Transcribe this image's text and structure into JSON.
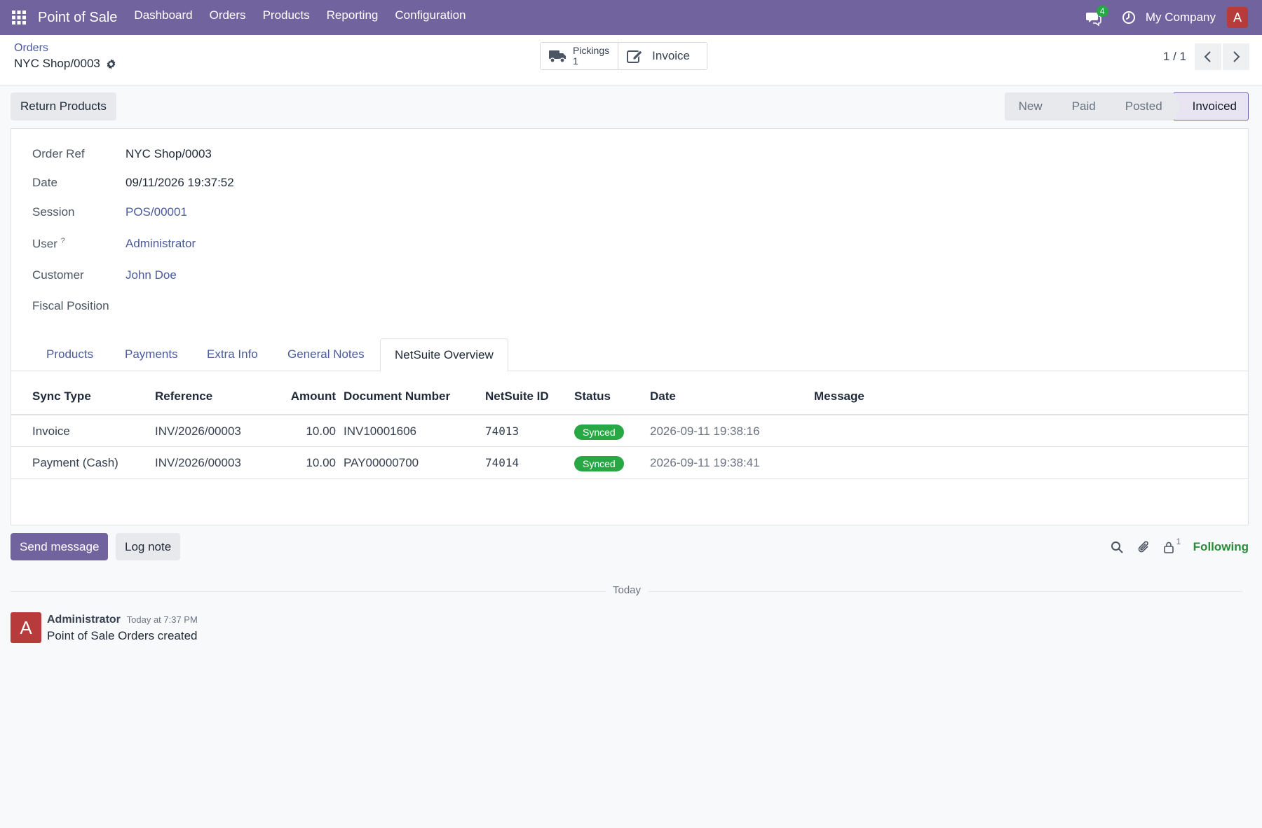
{
  "navbar": {
    "app_name": "Point of Sale",
    "menu": [
      "Dashboard",
      "Orders",
      "Products",
      "Reporting",
      "Configuration"
    ],
    "chat_count": "4",
    "company": "My Company",
    "avatar_letter": "A",
    "icons": [
      "apps-grid-icon",
      "chat-icon",
      "clock-icon"
    ]
  },
  "breadcrumb": {
    "parent": "Orders",
    "current": "NYC Shop/0003"
  },
  "smart_buttons": {
    "pickings_label": "Pickings",
    "pickings_count": "1",
    "invoice_label": "Invoice"
  },
  "pager": {
    "value": "1 / 1"
  },
  "actions": {
    "return_products": "Return Products"
  },
  "statusbar": {
    "stages": [
      "New",
      "Paid",
      "Posted",
      "Invoiced"
    ],
    "current": "Invoiced"
  },
  "form": {
    "order_ref_label": "Order Ref",
    "order_ref": "NYC Shop/0003",
    "date_label": "Date",
    "date": "09/11/2026 19:37:52",
    "session_label": "Session",
    "session": "POS/00001",
    "user_label": "User",
    "user_help": "?",
    "user": "Administrator",
    "customer_label": "Customer",
    "customer": "John Doe",
    "fiscal_label": "Fiscal Position",
    "fiscal": ""
  },
  "tabs": [
    "Products",
    "Payments",
    "Extra Info",
    "General Notes",
    "NetSuite Overview"
  ],
  "active_tab": "NetSuite Overview",
  "netsuite": {
    "columns": [
      "Sync Type",
      "Reference",
      "Amount",
      "Document Number",
      "NetSuite ID",
      "Status",
      "Date",
      "Message"
    ],
    "rows": [
      {
        "sync_type": "Invoice",
        "reference": "INV/2026/00003",
        "amount": "10.00",
        "document_number": "INV10001606",
        "netsuite_id": "74013",
        "status": "Synced",
        "date": "2026-09-11 19:38:16",
        "message": ""
      },
      {
        "sync_type": "Payment (Cash)",
        "reference": "INV/2026/00003",
        "amount": "10.00",
        "document_number": "PAY00000700",
        "netsuite_id": "74014",
        "status": "Synced",
        "date": "2026-09-11 19:38:41",
        "message": ""
      }
    ],
    "status_color": "#28a745"
  },
  "chatter": {
    "send_message": "Send message",
    "log_note": "Log note",
    "followers_count": "1",
    "following": "Following",
    "day_label": "Today",
    "message": {
      "avatar_letter": "A",
      "author": "Administrator",
      "time": "Today at 7:37 PM",
      "body": "Point of Sale Orders created"
    }
  },
  "colors": {
    "brand": "#71639e",
    "link": "#4a5a9c",
    "success": "#28a745",
    "avatar": "#b83b3b"
  }
}
